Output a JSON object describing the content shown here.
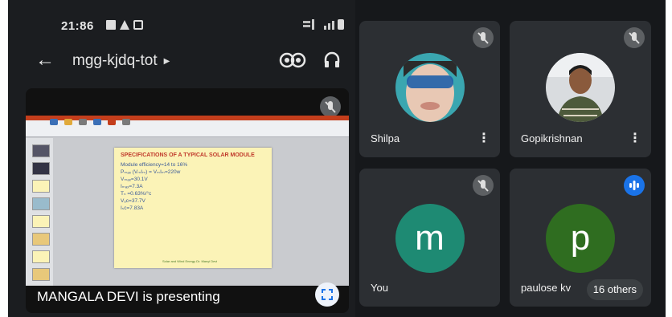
{
  "status": {
    "time": "21:86",
    "left_icons": [
      "image-icon",
      "warning-icon",
      "download-icon"
    ],
    "right_icons": [
      "network-icon",
      "signal-icon",
      "battery-icon"
    ]
  },
  "meeting": {
    "code": "mgg-kjdq-tot"
  },
  "presentation": {
    "presenter_text": "MANGALA DEVI is presenting",
    "slide": {
      "title": "SPECIFICATIONS OF A TYPICAL SOLAR MODULE",
      "lines": [
        "Module efficiency=14 to 16%",
        "Pₘₐₓ (VₘIₘ) = VₘIₘ=220w",
        "Vₘₐₓ=30.1V",
        "Iₘₐₓ=7.3A",
        "Tₙ =0.63%/°c",
        "Vₒᴄ=37.7V",
        "Iₛᴄ=7.83A"
      ],
      "footer": "Solar and Wind Energy Dr. Manyi Devi"
    }
  },
  "participants": [
    {
      "name": "Shilpa",
      "mic": "muted"
    },
    {
      "name": "Gopikrishnan",
      "mic": "muted"
    },
    {
      "name": "You",
      "initial": "m",
      "avatar_color": "#1e8a73",
      "mic": "muted"
    },
    {
      "name": "paulose kv",
      "initial": "p",
      "avatar_color": "#2f6d20",
      "mic": "speaking"
    }
  ],
  "others_label": "16 others",
  "colors": {
    "background": "#16181b",
    "tile": "#2c2f33",
    "speaking": "#1a73e8"
  }
}
